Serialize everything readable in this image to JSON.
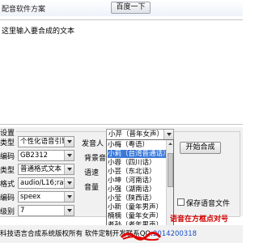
{
  "window": {
    "title": "配音软件方案"
  },
  "toolbar": {
    "baidu_button": "百度一下"
  },
  "editor": {
    "placeholder_text": "这里输入要合成的文本"
  },
  "settings": {
    "legend": "设置",
    "rows": [
      {
        "label": "类型",
        "value": "个性化语音引擎"
      },
      {
        "label": "编码",
        "value": "GB2312"
      },
      {
        "label": "类型",
        "value": "普通格式文本"
      },
      {
        "label": "格式",
        "value": "audio/L16;rate="
      },
      {
        "label": "编码",
        "value": "speex"
      },
      {
        "label": "级别",
        "value": "7"
      }
    ],
    "side_labels": {
      "speaker": "发音人",
      "background": "背景音",
      "speed": "语速",
      "volume": "音量"
    },
    "speaker_selected": "小芹（普年女声）"
  },
  "speaker_list": {
    "items": [
      "小梅（粤语）",
      "小莉（台湾普通话）",
      "小蓉（四川话）",
      "小芸（东北话）",
      "小坤（河南话）",
      "小强（湖南话）",
      "小莹（陕西话）",
      "小新（童年男声）",
      "楠楠（童年女声）",
      "老孙（老年男声）"
    ],
    "selected_index": 1
  },
  "actions": {
    "start_button": "开始合成",
    "save_checkbox_label": "保存语音文件",
    "red_notice": "语音在方框点对号"
  },
  "footer": {
    "copyright": "科技语言合成系统版权所有 软件定制开发联系QQ:",
    "qq": "2014200318"
  }
}
